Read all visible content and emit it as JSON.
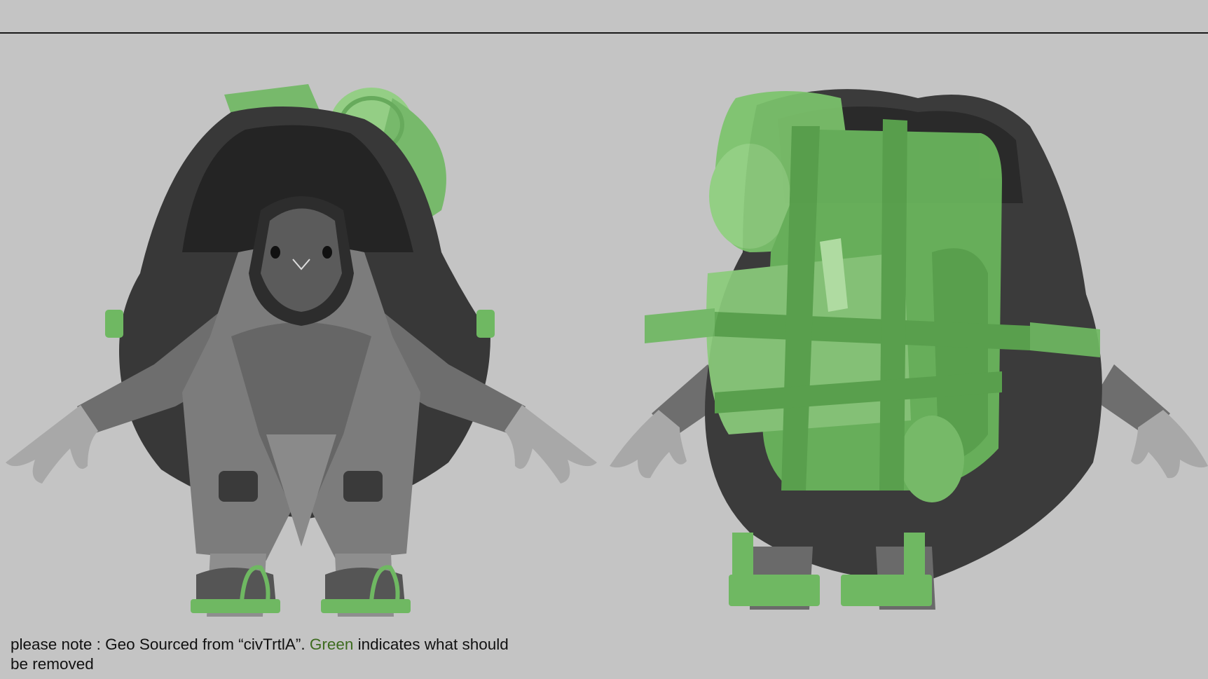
{
  "note": {
    "prefix": "please note : Geo Sourced from “civTrtlA”. ",
    "highlight": "Green",
    "suffix": " indicates what should be removed"
  },
  "colors": {
    "background": "#c4c4c4",
    "removal_highlight": "#7bc46c",
    "highlight_text": "#3d6b1f",
    "shell": "#3a3a3a",
    "body": "#7a7a7a"
  },
  "views": [
    {
      "name": "front-view",
      "icon": "turtle-character-front-icon"
    },
    {
      "name": "back-view",
      "icon": "turtle-character-back-icon"
    }
  ]
}
